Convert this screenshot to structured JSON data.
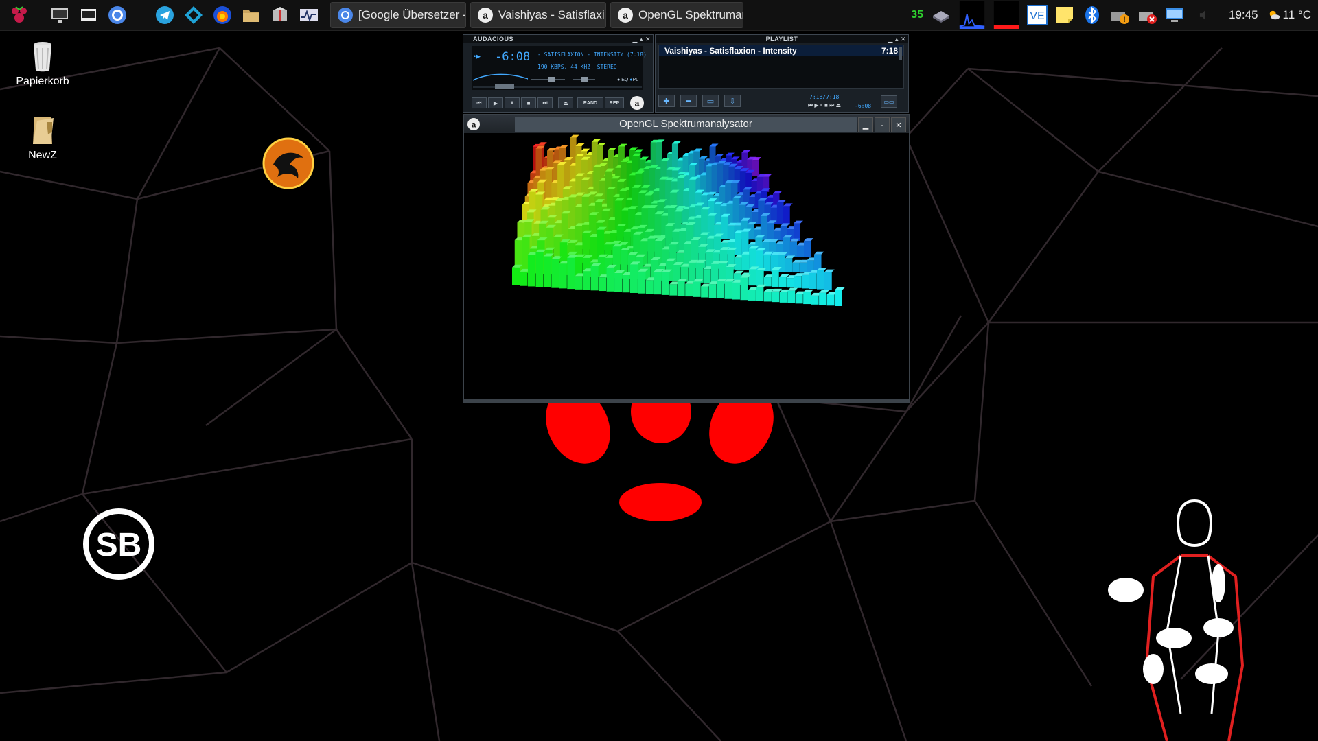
{
  "taskbar": {
    "tasks": [
      {
        "label": "[Google Übersetzer - ..."
      },
      {
        "label": "Vaishiyas - Satisflaxi..."
      },
      {
        "label": "OpenGL Spektruman..."
      }
    ],
    "tray_temp": "35",
    "clock": "19:45",
    "weather": "11 °C",
    "ve_label": "VE"
  },
  "desktop": {
    "icons": [
      {
        "label": "Papierkorb"
      },
      {
        "label": "NewZ"
      }
    ]
  },
  "audacious": {
    "title": "AUDACIOUS",
    "time": "-6:08",
    "scroll_text": "- SATISFLAXION - INTENSITY (7:18)",
    "info_text": "190 KBPS. 44 KHZ. STEREO",
    "eq_label": "EQ",
    "pl_label": "PL",
    "rand_label": "RAND",
    "rep_label": "REP"
  },
  "playlist": {
    "title": "PLAYLIST",
    "items": [
      {
        "title": "Vaishiyas - Satisflaxion - Intensity",
        "duration": "7:18"
      }
    ],
    "time_display": "7:18/7:18",
    "remaining": "-6:08"
  },
  "gl_window": {
    "title": "OpenGL Spektrumanalysator"
  },
  "wallpaper": {
    "logo_text": "SB"
  },
  "colors": {
    "accent": "#42a9ff",
    "temp_green": "#2fd22f",
    "rpi_red": "#ff0000"
  }
}
